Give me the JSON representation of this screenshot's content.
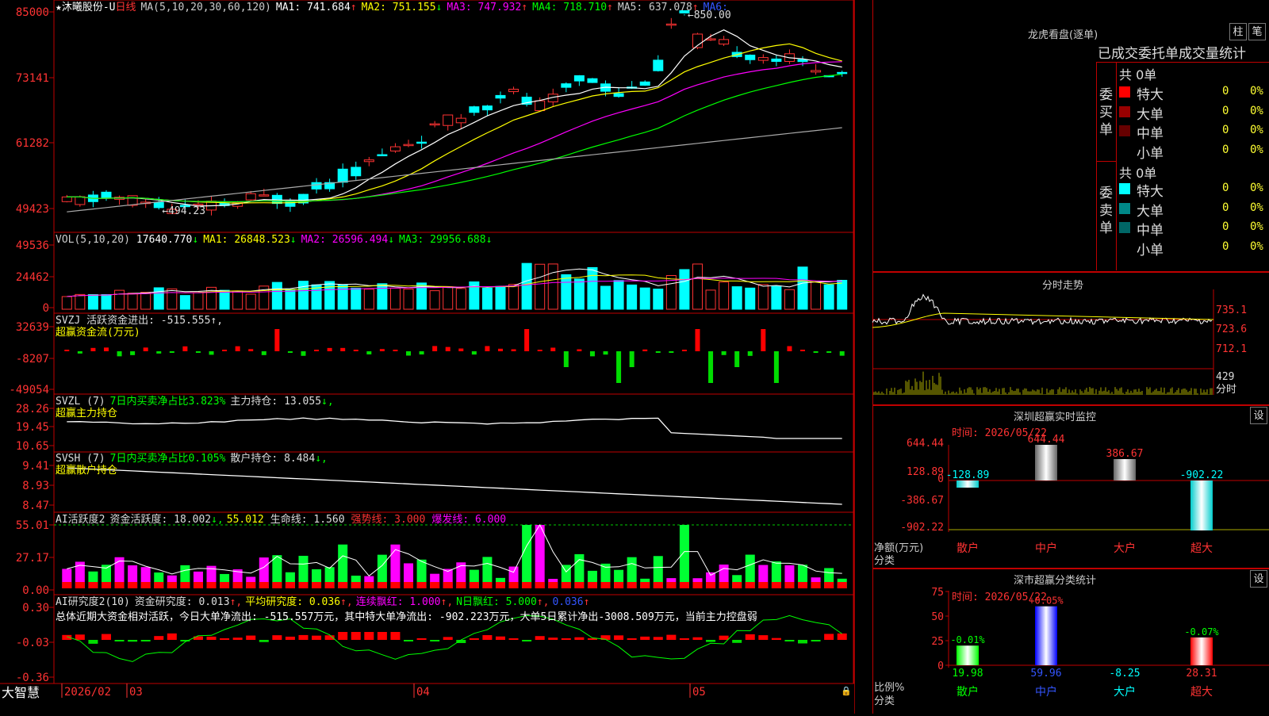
{
  "main": {
    "stock_name": "★沐曦股份-U",
    "period": "日线",
    "ma_title": "MA(5,10,20,30,60,120)",
    "ma_values": [
      {
        "label": "MA1: 741.684",
        "arrow": "↑",
        "color": "#ffffff"
      },
      {
        "label": "MA2: 751.155",
        "arrow": "↓",
        "color": "#ffff00"
      },
      {
        "label": "MA3: 747.932",
        "arrow": "↑",
        "color": "#ff00ff"
      },
      {
        "label": "MA4: 718.710",
        "arrow": "↑",
        "color": "#00ff00"
      },
      {
        "label": "MA5: 637.078",
        "arrow": "↑",
        "color": "#cccccc"
      },
      {
        "label": "MA6:",
        "arrow": "",
        "color": "#3355ff"
      }
    ],
    "y_ticks": [
      "85000",
      "73141",
      "61282",
      "49423"
    ],
    "high_label": "850.00",
    "low_label": "494.23"
  },
  "vol": {
    "title": "VOL(5,10,20)",
    "value": "17640.770",
    "ma1": "MA1: 26848.523",
    "ma2": "MA2: 26596.494",
    "ma3": "MA3: 29956.688",
    "y_ticks": [
      "49536",
      "24462",
      "0"
    ]
  },
  "svzj": {
    "title": "SVZJ  活跃资金进出: -515.555",
    "subtitle": "超赢资金流(万元)",
    "y_ticks": [
      "32639",
      "-8207",
      "-49054"
    ]
  },
  "svzl": {
    "title": "SVZL (7)",
    "t1": "7日内买卖净占比3.823%",
    "t2": "主力持仓: 13.055",
    "subtitle": "超赢主力持仓",
    "y_ticks": [
      "28.26",
      "19.45",
      "10.65"
    ]
  },
  "svsh": {
    "title": "SVSH (7)",
    "t1": "7日内买卖净占比0.105%",
    "t2": "散户持仓: 8.484",
    "subtitle": "超赢散户持仓",
    "y_ticks": [
      "9.41",
      "8.93",
      "8.47"
    ]
  },
  "ai1": {
    "title": "AI活跃度2",
    "t1": "资金活跃度: 18.002",
    "t2": "55.012",
    "t3": "生命线: 1.560",
    "t4": "强势线: 3.000",
    "t5": "爆发线: 6.000",
    "y_ticks": [
      "55.01",
      "27.17",
      "0.00"
    ]
  },
  "ai2": {
    "title": "AI研究度2(10)",
    "t1": "资金研究度: 0.013",
    "t2": "平均研究度: 0.036",
    "t3": "连续飘红: 1.000",
    "t4": "N日飘红: 5.000",
    "t5": "0.036",
    "summary": "总体近期大资金相对活跃，今日大单净流出: -515.557万元，其中特大单净流出: -902.223万元，大单5日累计净出-3008.509万元，当前主力控盘弱",
    "y_ticks": [
      "0.30",
      "-0.03",
      "-0.36"
    ]
  },
  "xaxis": {
    "labels": [
      "2026/02",
      "03",
      "04",
      "05"
    ],
    "brand": "大智慧"
  },
  "right": {
    "lhb_title": "龙虎看盘(逐单)",
    "btn_zhu": "柱",
    "btn_bi": "笔",
    "tabs_header": "已成交委托单成交量统计",
    "buy": {
      "label": "委买单",
      "total": "共 0单",
      "rows": [
        {
          "name": "特大",
          "count": "0",
          "pct": "0%",
          "color": "#ff0000"
        },
        {
          "name": "大单",
          "count": "0",
          "pct": "0%",
          "color": "#990000"
        },
        {
          "name": "中单",
          "count": "0",
          "pct": "0%",
          "color": "#660000"
        },
        {
          "name": "小单",
          "count": "0",
          "pct": "0%",
          "color": ""
        }
      ]
    },
    "sell": {
      "label": "委卖单",
      "total": "共 0单",
      "rows": [
        {
          "name": "特大",
          "count": "0",
          "pct": "0%",
          "color": "#00ffff"
        },
        {
          "name": "大单",
          "count": "0",
          "pct": "0%",
          "color": "#008888"
        },
        {
          "name": "中单",
          "count": "0",
          "pct": "0%",
          "color": "#006666"
        },
        {
          "name": "小单",
          "count": "0",
          "pct": "0%",
          "color": ""
        }
      ]
    },
    "fenshi": {
      "title": "分时走势",
      "y_ticks": [
        "735.1",
        "723.6",
        "712.1"
      ],
      "vol_ticks": [
        "429",
        "分时"
      ]
    },
    "sz_monitor": {
      "title": "深圳超赢实时监控",
      "btn": "设",
      "date": "时间: 2026/05/22",
      "y_ticks": [
        "644.44",
        "128.89",
        "0",
        "-386.67",
        "-902.22"
      ],
      "side_label1": "净额(万元)",
      "side_label2": "分类",
      "categories": [
        "散户",
        "中户",
        "大户",
        "超大"
      ],
      "values": [
        -128.89,
        644.44,
        386.67,
        -902.22
      ],
      "value_labels": [
        "-128.89",
        "644.44",
        "386.67",
        "-902.22"
      ]
    },
    "sz_class": {
      "title": "深市超赢分类统计",
      "btn": "设",
      "date": "时间: 2026/05/22",
      "y_ticks": [
        "75",
        "50",
        "25",
        "0"
      ],
      "side_label1": "比例%",
      "side_label2": "分类",
      "categories": [
        "散户",
        "中户",
        "大户",
        "超大"
      ],
      "values": [
        19.98,
        59.96,
        -8.25,
        28.31
      ],
      "value_labels": [
        "19.98",
        "59.96",
        "-8.25",
        "28.31"
      ],
      "change_labels": [
        "-0.01%",
        "+0.05%",
        "",
        "-0.07%"
      ]
    }
  }
}
